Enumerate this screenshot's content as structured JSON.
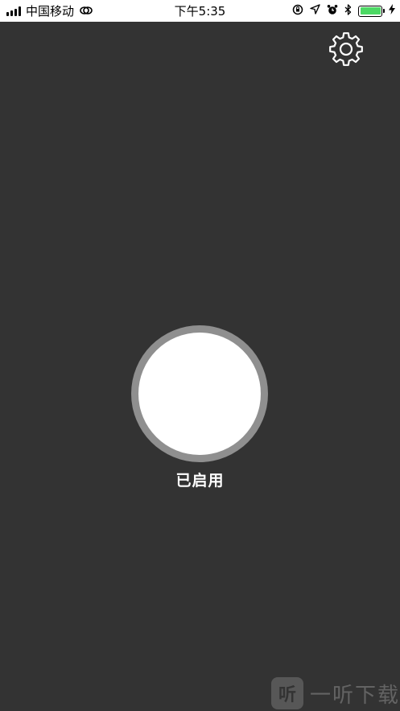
{
  "status_bar": {
    "carrier": "中国移动",
    "time": "下午5:35",
    "battery_level": 1.0
  },
  "icons": {
    "settings": "gear-icon",
    "signal": "signal-bars-icon",
    "link": "link-icon",
    "orientation_lock": "orientation-lock-icon",
    "location": "location-arrow-icon",
    "alarm": "alarm-icon",
    "bluetooth": "bluetooth-icon",
    "battery": "battery-icon",
    "charging": "charging-bolt-icon"
  },
  "main": {
    "status_label": "已启用"
  },
  "watermark": {
    "logo_char": "听",
    "text": "一听下载"
  },
  "colors": {
    "background": "#333333",
    "button_ring": "#8f8f8f",
    "button_fill": "#ffffff",
    "battery_fill": "#4cd964"
  }
}
